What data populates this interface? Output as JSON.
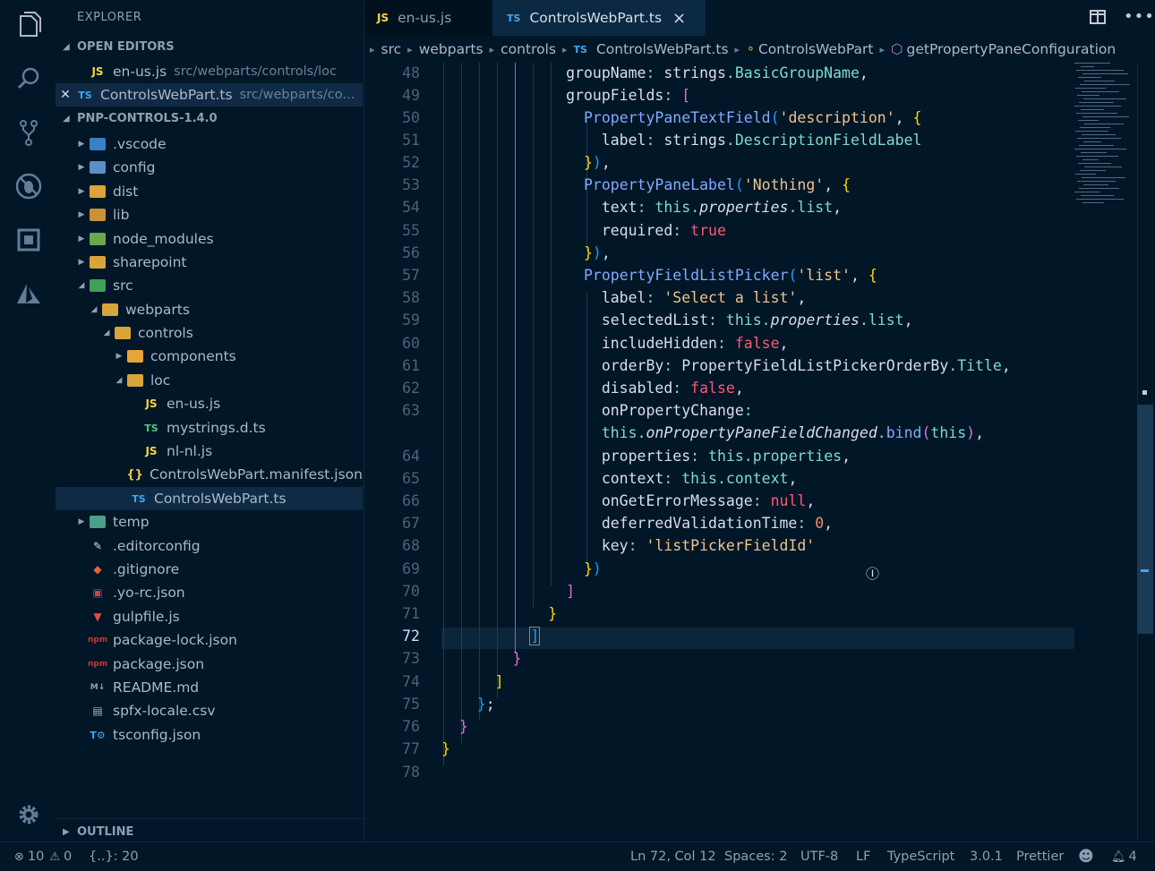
{
  "sidebar": {
    "title": "EXPLORER",
    "open_editors_label": "OPEN EDITORS",
    "open_editors": [
      {
        "icon": "JS",
        "name": "en-us.js",
        "path": "src/webparts/controls/loc"
      },
      {
        "icon": "TS",
        "name": "ControlsWebPart.ts",
        "path": "src/webparts/co..."
      }
    ],
    "project_label": "PNP-CONTROLS-1.4.0",
    "tree": [
      {
        "name": ".vscode",
        "icon": "folder-vscode"
      },
      {
        "name": "config",
        "icon": "folder-config"
      },
      {
        "name": "dist",
        "icon": "folder-dist"
      },
      {
        "name": "lib",
        "icon": "folder-lib"
      },
      {
        "name": "node_modules",
        "icon": "folder-node"
      },
      {
        "name": "sharepoint",
        "icon": "folder"
      },
      {
        "name": "src",
        "icon": "folder-src"
      },
      {
        "name": "webparts",
        "icon": "folder-open"
      },
      {
        "name": "controls",
        "icon": "folder-open"
      },
      {
        "name": "components",
        "icon": "folder-components"
      },
      {
        "name": "loc",
        "icon": "folder-open"
      },
      {
        "name": "en-us.js",
        "icon": "JS"
      },
      {
        "name": "mystrings.d.ts",
        "icon": "TS"
      },
      {
        "name": "nl-nl.js",
        "icon": "JS"
      },
      {
        "name": "ControlsWebPart.manifest.json",
        "icon": "{}"
      },
      {
        "name": "ControlsWebPart.ts",
        "icon": "TS"
      },
      {
        "name": "temp",
        "icon": "folder-temp"
      },
      {
        "name": ".editorconfig",
        "icon": "editorconfig"
      },
      {
        "name": ".gitignore",
        "icon": "git"
      },
      {
        "name": ".yo-rc.json",
        "icon": "yeoman"
      },
      {
        "name": "gulpfile.js",
        "icon": "gulp"
      },
      {
        "name": "package-lock.json",
        "icon": "npm"
      },
      {
        "name": "package.json",
        "icon": "npm"
      },
      {
        "name": "README.md",
        "icon": "markdown"
      },
      {
        "name": "spfx-locale.csv",
        "icon": "csv"
      },
      {
        "name": "tsconfig.json",
        "icon": "tsconfig"
      }
    ],
    "outline_label": "OUTLINE"
  },
  "tabs": [
    {
      "icon": "JS",
      "label": "en-us.js",
      "active": false
    },
    {
      "icon": "TS",
      "label": "ControlsWebPart.ts",
      "active": true,
      "close": "×"
    }
  ],
  "breadcrumb": {
    "parts": [
      "src",
      "webparts",
      "controls"
    ],
    "file_icon": "TS",
    "file": "ControlsWebPart.ts",
    "class": "ControlsWebPart",
    "method": "getPropertyPaneConfiguration"
  },
  "editor": {
    "line_numbers": [
      "48",
      "49",
      "50",
      "51",
      "52",
      "53",
      "54",
      "55",
      "56",
      "57",
      "58",
      "59",
      "60",
      "61",
      "62",
      "63",
      "",
      "64",
      "65",
      "66",
      "67",
      "68",
      "69",
      "70",
      "71",
      "72",
      "73",
      "74",
      "75",
      "76",
      "77",
      "78"
    ],
    "current_line": "72"
  },
  "status": {
    "errors": "10",
    "warnings": "0",
    "brackets": "{..}: 20",
    "position": "Ln 72, Col 12",
    "spaces": "Spaces: 2",
    "encoding": "UTF-8",
    "eol": "LF",
    "language": "TypeScript",
    "ts_version": "3.0.1",
    "formatter": "Prettier",
    "notifications": "4"
  },
  "colors": {
    "background": "#011627",
    "keyword": "#c792ea",
    "string": "#ecc48d",
    "function": "#82aaff",
    "property": "#7fdbca",
    "boolean": "#ff5874"
  }
}
